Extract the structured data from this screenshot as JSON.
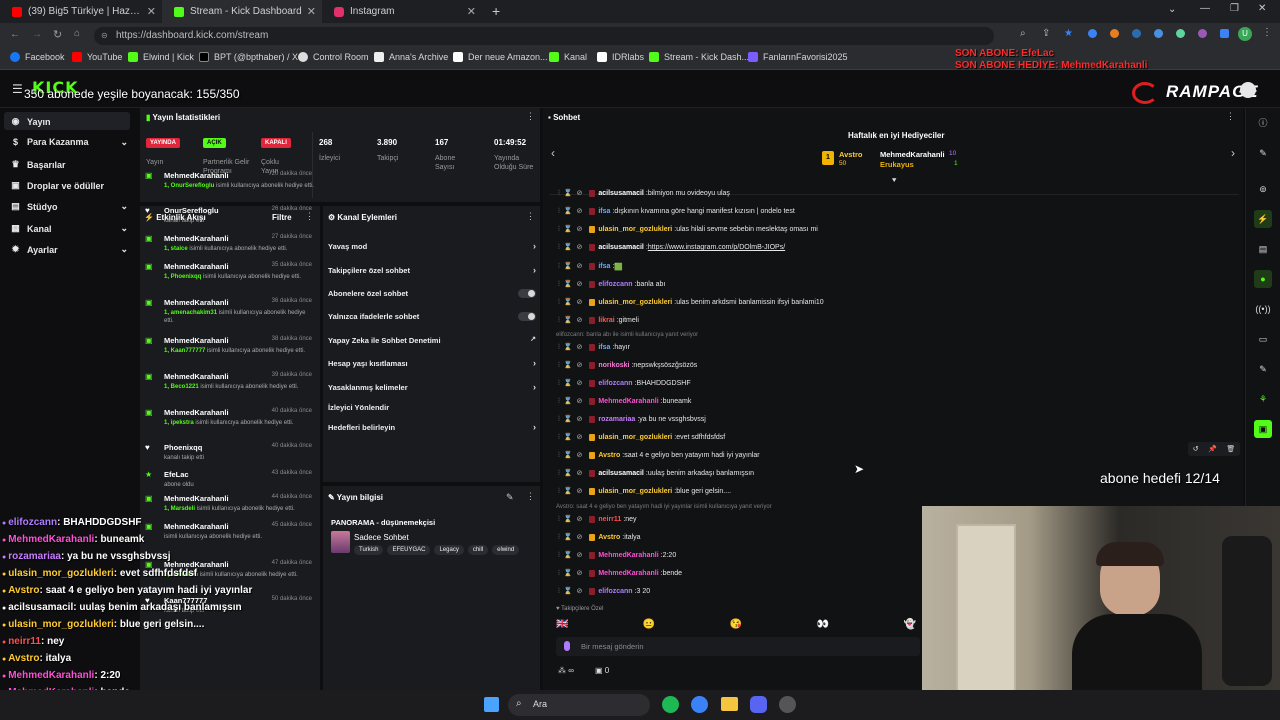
{
  "browser": {
    "tabs": [
      {
        "title": "(39) Big5 Türkiye | Hazırlık Sezon",
        "icon": "youtube-icon",
        "color": "#ff0000"
      },
      {
        "title": "Stream - Kick Dashboard",
        "icon": "kick-icon",
        "color": "#53fc18"
      },
      {
        "title": "Instagram",
        "icon": "instagram-icon",
        "color": "#e1306c"
      }
    ],
    "url": "https://dashboard.kick.com/stream",
    "bookmarks": [
      "Facebook",
      "YouTube",
      "Elwind | Kick",
      "BPT (@bpthaber) / X",
      "Control Room",
      "Anna's Archive",
      "Der neue Amazon...",
      "Kanal",
      "IDRlabs",
      "Stream - Kick Dash...",
      "FanlarınFavorisi2025"
    ]
  },
  "overlay": {
    "sub_goal_text": "350 abonede yeşile boyanacak: 155/350",
    "last_sub_1": "SON ABONE: EfeLac",
    "last_sub_2": "SON ABONE HEDİYE: MehmedKarahanli",
    "brand": "RAMPAGE",
    "sub_target": "abone hedefi 12/14",
    "chat": [
      {
        "user": "elifozcann",
        "msg": "BHAHDDGDSHF",
        "color": "#b07cff"
      },
      {
        "user": "MehmedKarahanli",
        "msg": "buneamk",
        "color": "#ff4fd8"
      },
      {
        "user": "rozamariaa",
        "msg": "ya bu ne vssghsbvssj",
        "color": "#c77dff"
      },
      {
        "user": "ulasin_mor_gozlukleri",
        "msg": "evet sdfhfdsfdsf",
        "color": "#ffcc33"
      },
      {
        "user": "Avstro",
        "msg": "saat 4 e geliyo ben yatayım hadi iyi yayınlar",
        "color": "#ffcc33"
      },
      {
        "user": "acilsusamacil",
        "msg": "uulaş benim arkadaşı banlamışsın",
        "color": "#ffffff"
      },
      {
        "user": "ulasin_mor_gozlukleri",
        "msg": "blue geri gelsin....",
        "color": "#ffcc33"
      },
      {
        "user": "neirr11",
        "msg": "ney",
        "color": "#ff4f4f"
      },
      {
        "user": "Avstro",
        "msg": "italya",
        "color": "#ffcc33"
      },
      {
        "user": "MehmedKarahanli",
        "msg": "2:20",
        "color": "#ff4fd8"
      },
      {
        "user": "MehmedKarahanli",
        "msg": "bende",
        "color": "#ff4fd8"
      },
      {
        "user": "elifozcann",
        "msg": "3 20",
        "color": "#b07cff"
      }
    ]
  },
  "sidebar": {
    "logo": "KICK",
    "items": [
      {
        "label": "Yayın",
        "icon": "broadcast-icon"
      },
      {
        "label": "Para Kazanma",
        "icon": "money-icon"
      },
      {
        "label": "Başarılar",
        "icon": "trophy-icon"
      },
      {
        "label": "Droplar ve ödüller",
        "icon": "gift-icon"
      },
      {
        "label": "Stüdyo",
        "icon": "studio-icon"
      },
      {
        "label": "Kanal",
        "icon": "channel-icon"
      },
      {
        "label": "Ayarlar",
        "icon": "settings-icon"
      }
    ]
  },
  "stats": {
    "title": "Yayın İstatistikleri",
    "badges": [
      {
        "badge": "YAYINDA",
        "label": "Yayın",
        "color": "#e0263a"
      },
      {
        "badge": "AÇIK",
        "label": "Partnerlik Gelir Programı",
        "color": "#53fc18"
      },
      {
        "badge": "KAPALI",
        "label": "Çoklu Yayın",
        "color": "#e0263a"
      }
    ],
    "numbers": [
      {
        "value": "268",
        "label": "İzleyici"
      },
      {
        "value": "3.890",
        "label": "Takipçi"
      },
      {
        "value": "167",
        "label": "Abone Sayısı"
      },
      {
        "value": "01:49:52",
        "label": "Yayında Olduğu Süre"
      }
    ]
  },
  "activity": {
    "title": "Etkinlik Akışı",
    "filter": "Filtre",
    "items": [
      {
        "name": "MehmedKarahanli",
        "time": "20 dakika önce",
        "desc_user": "1, OnurSerefloglu",
        "desc": "isimli kullanıcıya abonelik hediye etti.",
        "type": "gift"
      },
      {
        "name": "OnurSerefloglu",
        "time": "26 dakika önce",
        "desc_user": "",
        "desc": "kanalı takip etti",
        "type": "follow"
      },
      {
        "name": "MehmedKarahanli",
        "time": "27 dakika önce",
        "desc_user": "1, staice",
        "desc": "isimli kullanıcıya abonelik hediye etti.",
        "type": "gift"
      },
      {
        "name": "MehmedKarahanli",
        "time": "35 dakika önce",
        "desc_user": "1, Phoenixqq",
        "desc": "isimli kullanıcıya abonelik hediye etti.",
        "type": "gift"
      },
      {
        "name": "MehmedKarahanli",
        "time": "36 dakika önce",
        "desc_user": "1, amenachakim31",
        "desc": "isimli kullanıcıya abonelik hediye etti.",
        "type": "gift"
      },
      {
        "name": "MehmedKarahanli",
        "time": "38 dakika önce",
        "desc_user": "1, Kaan777777",
        "desc": "isimli kullanıcıya abonelik hediye etti.",
        "type": "gift"
      },
      {
        "name": "MehmedKarahanli",
        "time": "39 dakika önce",
        "desc_user": "1, Beco1221",
        "desc": "isimli kullanıcıya abonelik hediye etti.",
        "type": "gift"
      },
      {
        "name": "MehmedKarahanli",
        "time": "40 dakika önce",
        "desc_user": "1, ipekstra",
        "desc": "isimli kullanıcıya abonelik hediye etti.",
        "type": "gift"
      },
      {
        "name": "Phoenixqq",
        "time": "40 dakika önce",
        "desc_user": "",
        "desc": "kanalı takip etti",
        "type": "follow"
      },
      {
        "name": "EfeLac",
        "time": "43 dakika önce",
        "desc_user": "",
        "desc": "abone oldu",
        "type": "sub"
      },
      {
        "name": "MehmedKarahanli",
        "time": "44 dakika önce",
        "desc_user": "1, Marsdeli",
        "desc": "isimli kullanıcıya abonelik hediye etti.",
        "type": "gift"
      },
      {
        "name": "MehmedKarahanli",
        "time": "45 dakika önce",
        "desc_user": "",
        "desc": "isimli kullanıcıya abonelik hediye etti.",
        "type": "gift"
      },
      {
        "name": "MehmedKarahanli",
        "time": "47 dakika önce",
        "desc_user": "1, melekkim",
        "desc": "isimli kullanıcıya abonelik hediye etti.",
        "type": "gift"
      },
      {
        "name": "Kaan777777",
        "time": "50 dakika önce",
        "desc_user": "",
        "desc": "kanalı takip etti",
        "type": "follow"
      }
    ]
  },
  "channel_actions": {
    "title": "Kanal Eylemleri",
    "rows": [
      {
        "label": "Yavaş mod",
        "control": "chevron"
      },
      {
        "label": "Takipçilere özel sohbet",
        "control": "chevron"
      },
      {
        "label": "Abonelere özel sohbet",
        "control": "toggle"
      },
      {
        "label": "Yalnızca ifadelerle sohbet",
        "control": "toggle"
      },
      {
        "label": "Yapay Zeka ile Sohbet Denetimi",
        "control": "external"
      },
      {
        "label": "Hesap yaşı kısıtlaması",
        "control": "chevron"
      },
      {
        "label": "Yasaklanmış kelimeler",
        "control": "chevron"
      },
      {
        "label": "İzleyici Yönlendir",
        "control": "none"
      },
      {
        "label": "Hedefleri belirleyin",
        "control": "chevron"
      }
    ]
  },
  "stream_info": {
    "title": "Yayın bilgisi",
    "stream_title": "PANORAMA - düşünemekçisi",
    "category": "Sadece Sohbet",
    "tags": [
      "Turkish",
      "EFEUYGAC",
      "Legacy",
      "chill",
      "elwind"
    ]
  },
  "chat": {
    "title": "Sohbet",
    "gifters_title": "Haftalık en iyi Hediyeciler",
    "gifters": [
      {
        "name": "Avstro",
        "count": "50"
      },
      {
        "name": "MehmedKarahanli",
        "count": "10"
      },
      {
        "name": "Erukayus",
        "count": "1"
      }
    ],
    "lines": [
      {
        "user": "acilsusamacil",
        "msg": "bilmiyon mu ovideoyu ulaş",
        "color": "#ffffff"
      },
      {
        "user": "ifsa",
        "msg": "dışkının kıvamına göre hangi manifest kızısın | ondelo test",
        "color": "#60b0ff"
      },
      {
        "user": "ulasin_mor_gozlukleri",
        "msg": "ulas hilali sevme sebebin meslektaş oması mi",
        "color": "#ffcc33"
      },
      {
        "user": "acilsusamacil",
        "msg": "https://www.instagram.com/p/DOlmB-JIOPs/",
        "color": "#ffffff"
      },
      {
        "user": "ifsa",
        "msg": "🟩",
        "color": "#60b0ff"
      },
      {
        "user": "elifozcann",
        "msg": "banla abı",
        "color": "#b07cff"
      },
      {
        "user": "ulasin_mor_gozlukleri",
        "msg": "ulas benim arkdsmi banlamissin ifsyi banlami10",
        "color": "#ffcc33"
      },
      {
        "user": "likrai",
        "msg": "gitmeli",
        "color": "#ff5a5a"
      },
      {
        "user": "ifsa",
        "msg": "hayır",
        "color": "#60b0ff"
      },
      {
        "user": "norikoski",
        "msg": "nepswkşsöszğsözös",
        "color": "#ff7ad9"
      },
      {
        "user": "elifozcann",
        "msg": "BHAHDDGDSHF",
        "color": "#b07cff"
      },
      {
        "user": "MehmedKarahanli",
        "msg": "buneamk",
        "color": "#ff4fd8"
      },
      {
        "user": "rozamariaa",
        "msg": "ya bu ne vssghsbvssj",
        "color": "#c77dff"
      },
      {
        "user": "ulasin_mor_gozlukleri",
        "msg": "evet sdfhfdsfdsf",
        "color": "#ffcc33"
      },
      {
        "user": "Avstro",
        "msg": "saat 4 e geliyo ben yatayım hadi iyi yayınlar",
        "color": "#ffcc33"
      },
      {
        "user": "acilsusamacil",
        "msg": "uulaş benim arkadaşı banlamışsın",
        "color": "#ffffff"
      },
      {
        "user": "ulasin_mor_gozlukleri",
        "msg": "blue geri gelsin....",
        "color": "#ffcc33"
      },
      {
        "user": "neirr11",
        "msg": "ney",
        "color": "#ff4f4f"
      },
      {
        "user": "Avstro",
        "msg": "italya",
        "color": "#ffcc33"
      },
      {
        "user": "MehmedKarahanli",
        "msg": "2:20",
        "color": "#ff4fd8"
      },
      {
        "user": "MehmedKarahanli",
        "msg": "bende",
        "color": "#ff4fd8"
      },
      {
        "user": "elifozcann",
        "msg": "3 20",
        "color": "#b07cff"
      }
    ],
    "reply1": "elifozcann: banla abı ile isimli kullanıcıya yanıt veriyor",
    "reply2": "Avstro: saat 4 e geliyo ben yatayım hadi iyi yayınlar isimli kullanıcıya yanıt veriyor",
    "followers_only": "Takipçilere Özel",
    "placeholder": "Bir mesaj gönderin",
    "footer_left": "∞",
    "footer_right": "0"
  },
  "taskbar": {
    "search": "Ara"
  }
}
